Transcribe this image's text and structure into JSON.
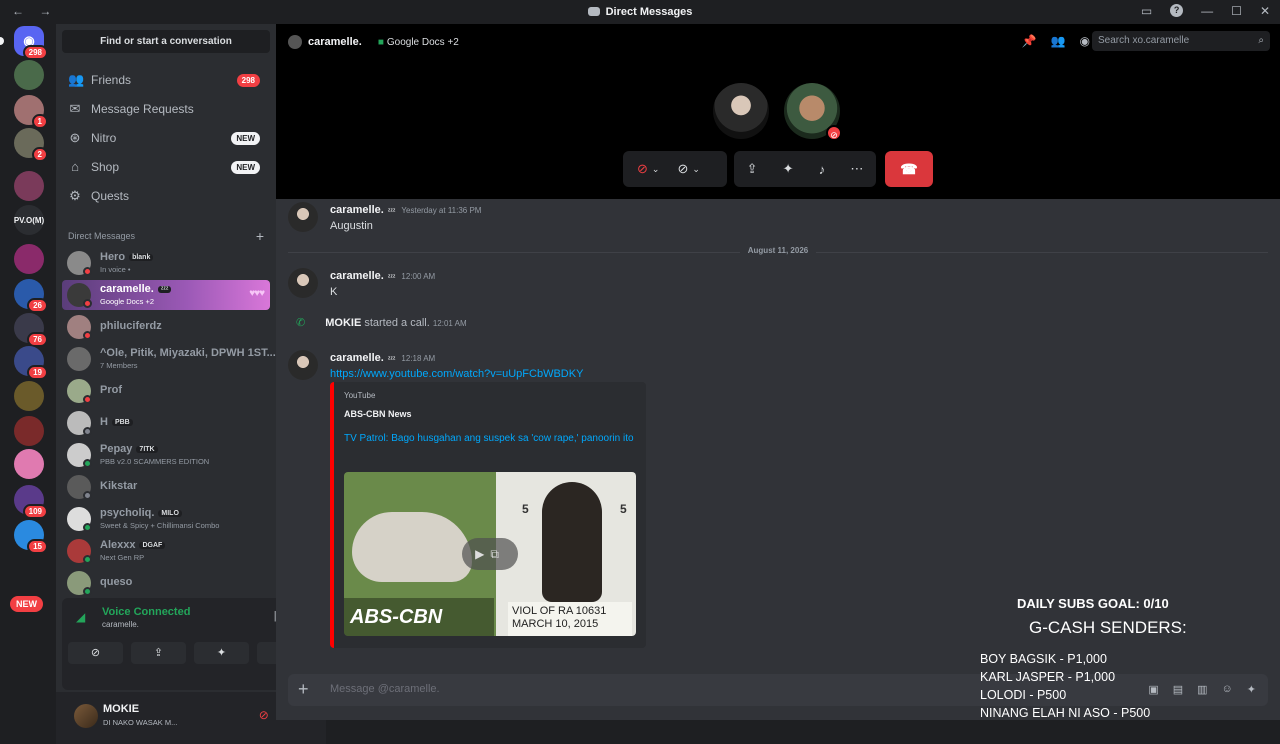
{
  "titlebar": {
    "title": "Direct Messages",
    "nav": "← →"
  },
  "rail": {
    "home_badge": "298",
    "servers": [
      {
        "name": "dm-1",
        "badge": "",
        "color": "#4a6a4a"
      },
      {
        "name": "dm-2",
        "badge": "1",
        "color": "#a07070"
      },
      {
        "name": "dm-3",
        "badge": "2",
        "color": "#6a6a5a"
      },
      {
        "name": "server-a",
        "badge": "",
        "color": "#7a3a5a"
      },
      {
        "name": "server-pvo",
        "badge": "",
        "label": "PV.O(M)"
      },
      {
        "name": "server-b",
        "badge": "",
        "color": "#8a2a6a"
      },
      {
        "name": "server-c",
        "badge": "26",
        "color": "#2a5aaa"
      },
      {
        "name": "server-d",
        "badge": "76",
        "color": "#3a3a4a"
      },
      {
        "name": "server-n",
        "badge": "19",
        "color": "#3a4a8a"
      },
      {
        "name": "server-e",
        "badge": "",
        "color": "#6a5a2a"
      },
      {
        "name": "server-f",
        "badge": "",
        "color": "#7a2a2a"
      },
      {
        "name": "server-g",
        "badge": "",
        "color": "#e07ab0"
      },
      {
        "name": "server-h",
        "badge": "109",
        "color": "#5a3a8a"
      },
      {
        "name": "server-i",
        "badge": "15",
        "color": "#2a8ae0"
      }
    ],
    "new_label": "NEW"
  },
  "sidebar": {
    "search_label": "Find or start a conversation",
    "nav": [
      {
        "label": "Friends",
        "icon": "friends-icon",
        "count": "298"
      },
      {
        "label": "Message Requests",
        "icon": "mail-icon"
      },
      {
        "label": "Nitro",
        "icon": "nitro-icon",
        "tag": "NEW"
      },
      {
        "label": "Shop",
        "icon": "shop-icon",
        "tag": "NEW"
      },
      {
        "label": "Quests",
        "icon": "quests-icon"
      }
    ],
    "dm_header": "Direct Messages",
    "dms": [
      {
        "name": "Hero",
        "tag": "blank",
        "sub": "In voice •",
        "color": "#8a8a8a",
        "status": "#f23f43"
      },
      {
        "name": "caramelle.",
        "tag": "ᶻᶻᶻ",
        "sub": "Google Docs +2",
        "color": "#3a3a3a",
        "status": "#f23f43"
      },
      {
        "name": "philuciferdz",
        "tag": "",
        "sub": "",
        "color": "#a08080",
        "status": "#f23f43"
      },
      {
        "name": "^Ole, Pitik, Miyazaki, DPWH 1ST...",
        "tag": "",
        "sub": "7 Members",
        "color": "#6a6a6a",
        "status": ""
      },
      {
        "name": "Prof",
        "tag": "",
        "sub": "",
        "color": "#9aaa8a",
        "status": "#f23f43"
      },
      {
        "name": "H",
        "tag": "PBB",
        "sub": "",
        "color": "#bbbbbb",
        "status": "#80848e"
      },
      {
        "name": "Pepay",
        "tag": "7ITK",
        "sub": "PBB v2.0 SCAMMERS EDITION",
        "color": "#cccccc",
        "status": "#23a55a"
      },
      {
        "name": "Kikstar",
        "tag": "",
        "sub": "",
        "color": "#5a5a5a",
        "status": "#80848e"
      },
      {
        "name": "psycholiq.",
        "tag": "MILO",
        "sub": "Sweet & Spicy + Chillimansi Combo",
        "color": "#dddddd",
        "status": "#23a55a"
      },
      {
        "name": "Alexxx",
        "tag": "DGAF",
        "sub": "Next Gen RP",
        "color": "#aa3a3a",
        "status": "#23a55a"
      },
      {
        "name": "queso",
        "tag": "",
        "sub": "",
        "color": "#8a9a7a",
        "status": "#23a55a"
      }
    ]
  },
  "voice": {
    "status": "Voice Connected",
    "channel": "caramelle."
  },
  "user": {
    "name": "MOKIE",
    "status": "DI NAKO WASAK M..."
  },
  "call": {
    "user": "caramelle.",
    "activity": "Google Docs +2",
    "search_placeholder": "Search xo.caramelle"
  },
  "messages": [
    {
      "author": "caramelle.",
      "tag": "ᶻᶻᶻ",
      "time": "Yesterday at 11:36 PM",
      "text": "Augustin"
    },
    {
      "author": "caramelle.",
      "tag": "ᶻᶻᶻ",
      "time": "12:00 AM",
      "text": "K"
    },
    {
      "author": "caramelle.",
      "tag": "ᶻᶻᶻ",
      "time": "12:18 AM",
      "text": "https://www.youtube.com/watch?v=uUpFCbWBDKY"
    }
  ],
  "date_divider": "August 11, 2026",
  "system": {
    "user": "MOKIE",
    "text": "started a call.",
    "time": "12:01 AM"
  },
  "embed": {
    "provider": "YouTube",
    "author": "ABS-CBN News",
    "title": "TV Patrol: Bago husgahan ang suspek sa 'cow rape,' panoorin ito",
    "thumb_logo": "ABS-CBN",
    "thumb_plate_1": "VIOL OF RA 10631",
    "thumb_plate_2": "MARCH 10, 2015",
    "thumb_num": "5"
  },
  "composer": {
    "placeholder": "Message @caramelle."
  },
  "overlay": {
    "goal": "DAILY SUBS GOAL: 0/10",
    "gcash": "G-CASH SENDERS:",
    "donors": [
      "BOY BAGSIK - P1,000",
      "KARL JASPER - P1,000",
      "LOLODI - P500",
      "NINANG ELAH NI ASO - P500"
    ]
  }
}
